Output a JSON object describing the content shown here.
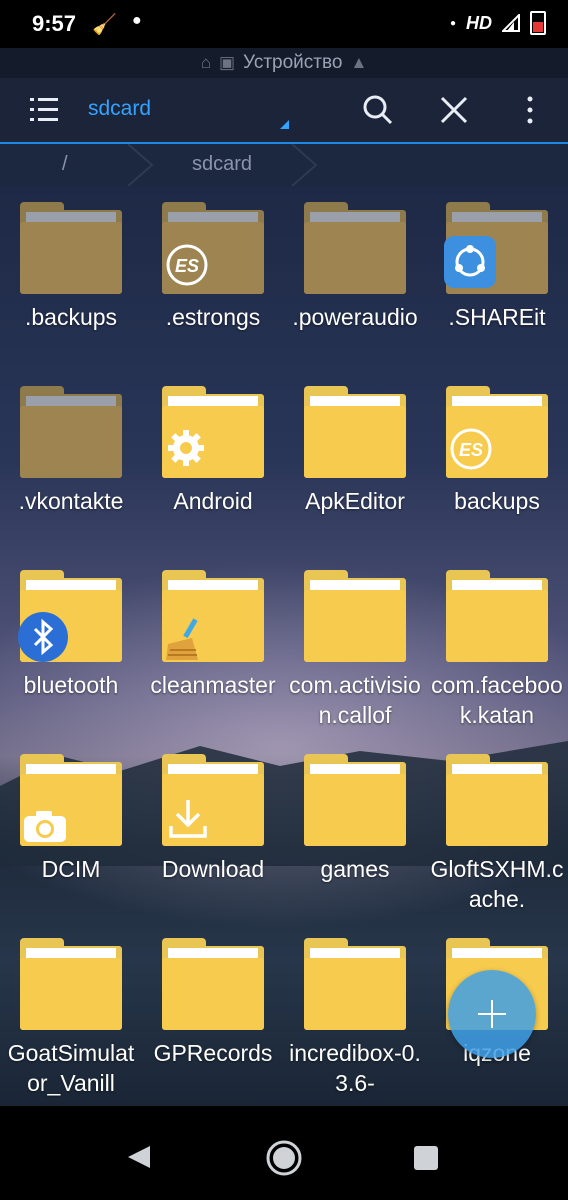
{
  "status_bar": {
    "time": "9:57",
    "network": "HD"
  },
  "location": {
    "label": "Устройство"
  },
  "toolbar": {
    "title": "sdcard"
  },
  "breadcrumb": {
    "root": "/",
    "current": "sdcard"
  },
  "files": [
    {
      "name": ".backups",
      "hidden": true,
      "overlay": "none"
    },
    {
      "name": ".estrongs",
      "hidden": true,
      "overlay": "es-logo-icon"
    },
    {
      "name": ".poweraudio",
      "hidden": true,
      "overlay": "none"
    },
    {
      "name": ".SHAREit",
      "hidden": true,
      "overlay": "shareit-icon"
    },
    {
      "name": ".vkontakte",
      "hidden": true,
      "overlay": "none"
    },
    {
      "name": "Android",
      "hidden": false,
      "overlay": "gear-icon"
    },
    {
      "name": "ApkEditor",
      "hidden": false,
      "overlay": "none"
    },
    {
      "name": "backups",
      "hidden": false,
      "overlay": "es-logo-icon"
    },
    {
      "name": "bluetooth",
      "hidden": false,
      "overlay": "bluetooth-icon"
    },
    {
      "name": "cleanmaster",
      "hidden": false,
      "overlay": "broom-icon"
    },
    {
      "name": "com.activision.callof",
      "hidden": false,
      "overlay": "none"
    },
    {
      "name": "com.facebook.katan",
      "hidden": false,
      "overlay": "none"
    },
    {
      "name": "DCIM",
      "hidden": false,
      "overlay": "camera-icon"
    },
    {
      "name": "Download",
      "hidden": false,
      "overlay": "download-icon"
    },
    {
      "name": "games",
      "hidden": false,
      "overlay": "none"
    },
    {
      "name": "GloftSXHM.cache.",
      "hidden": false,
      "overlay": "none"
    },
    {
      "name": "GoatSimulator_Vanill",
      "hidden": false,
      "overlay": "none"
    },
    {
      "name": "GPRecords",
      "hidden": false,
      "overlay": "none"
    },
    {
      "name": "incredibox-0.3.6-",
      "hidden": false,
      "overlay": "none"
    },
    {
      "name": "iqzone",
      "hidden": false,
      "overlay": "none"
    }
  ],
  "fab": {
    "icon": "plus-icon"
  },
  "colors": {
    "accent": "#33a3ff",
    "toolbar": "#1b2438",
    "folder": "#f7cb4d"
  }
}
